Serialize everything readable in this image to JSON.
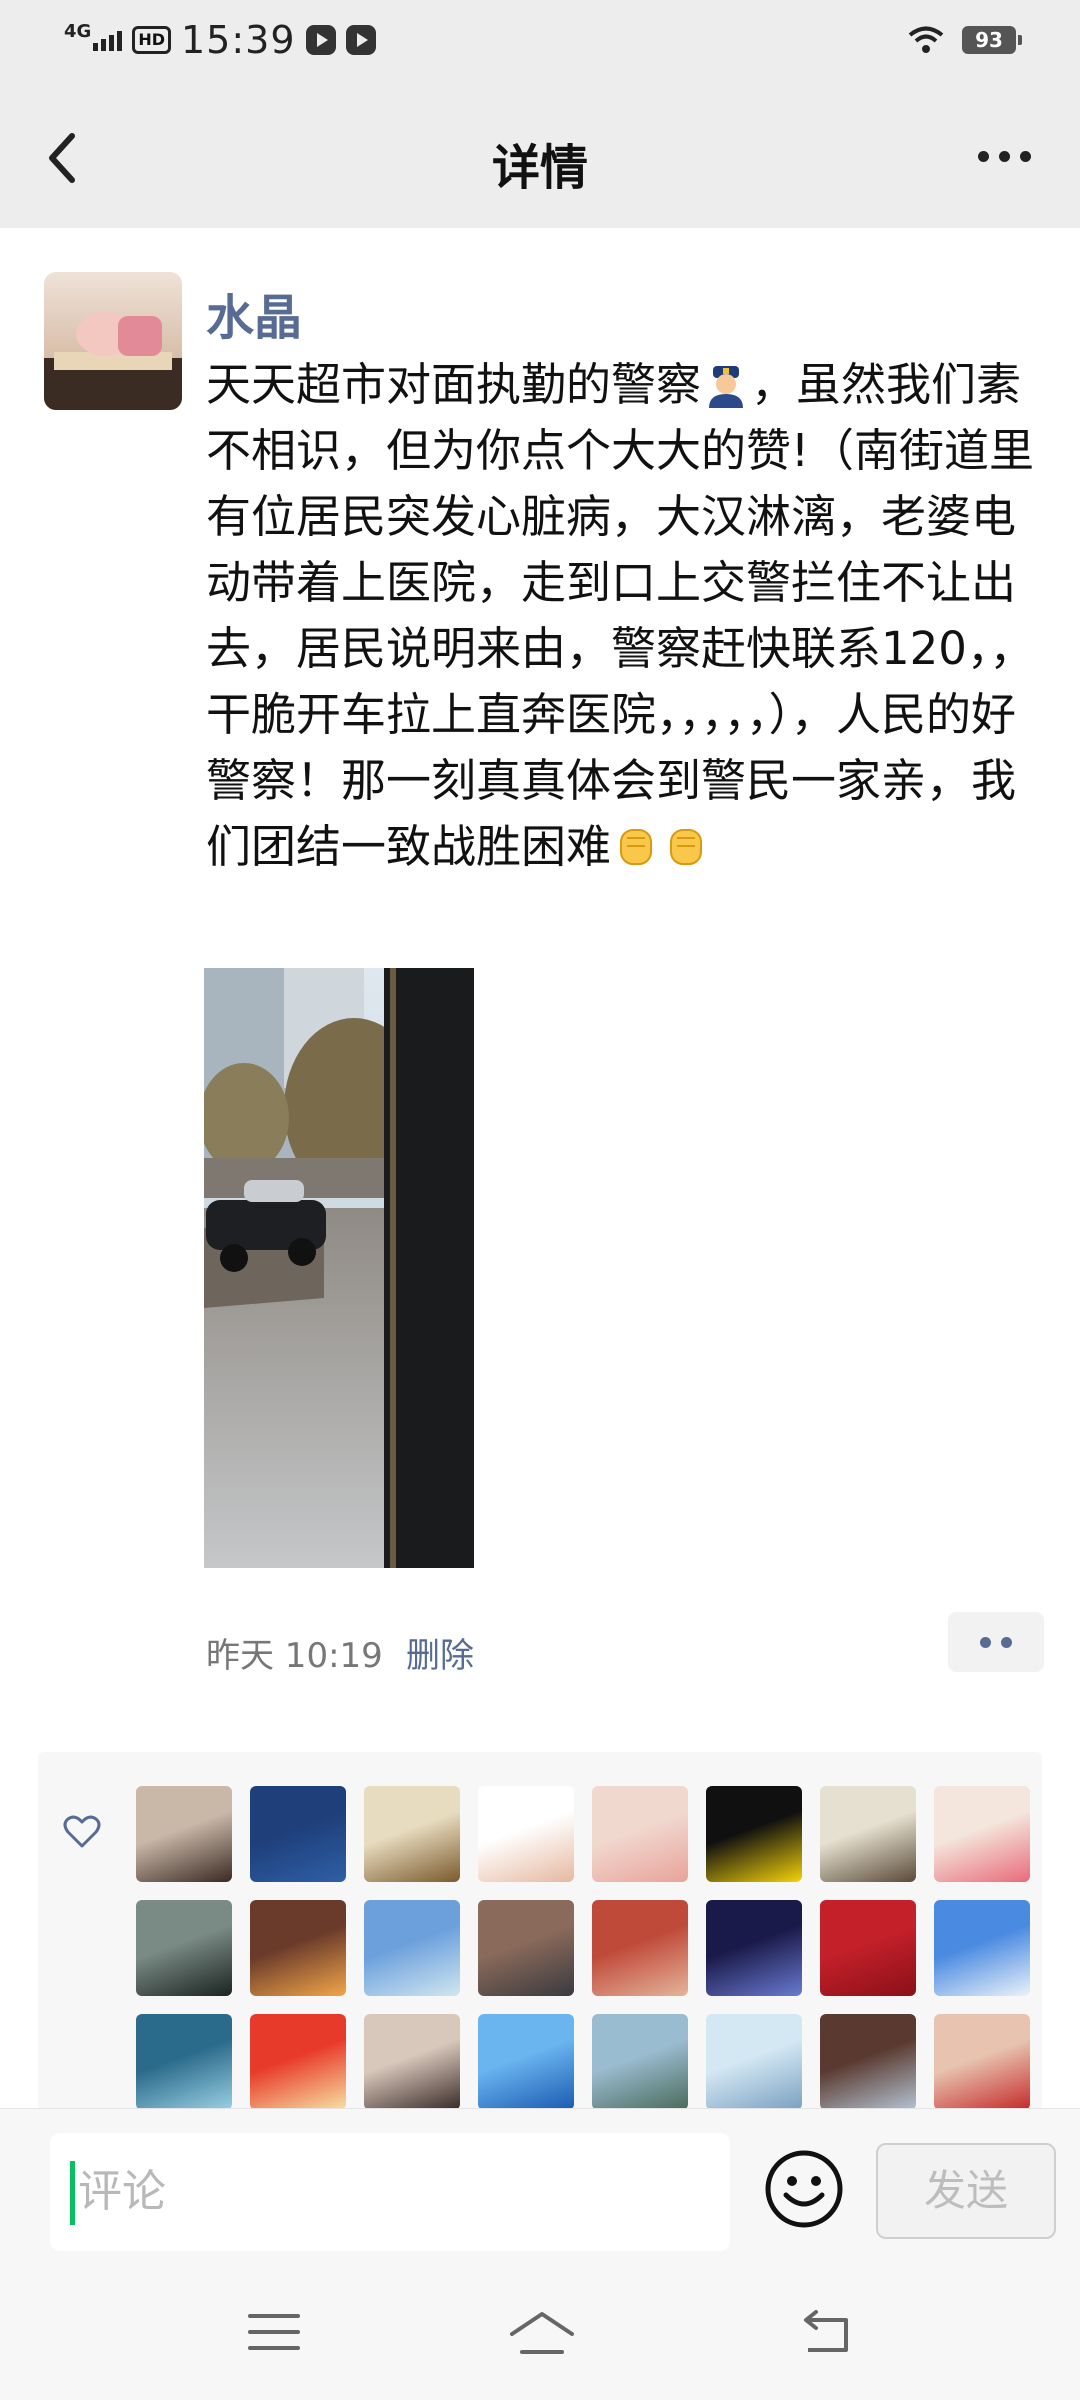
{
  "status_bar": {
    "network": "4G",
    "hd": "HD",
    "time": "15:39",
    "battery": "93"
  },
  "nav": {
    "title": "详情"
  },
  "post": {
    "author": "水晶",
    "text_parts": [
      "天天超市对面执勤的警察",
      "，虽然我们素不相识，但为你点个大大的赞!（南街道里有位居民突发心脏病，大汉淋漓，老婆电动带着上医院，走到口上交警拦住不让出去，居民说明来由，警察赶快联系120，，干脆开车拉上直奔医院，，，，，），人民的好警察！那一刻真真体会到警民一家亲，我们团结一致战胜困难"
    ],
    "icons": [
      "police-officer-emoji",
      "raised-fist-emoji",
      "raised-fist-emoji"
    ],
    "time": "昨天 10:19",
    "delete_label": "删除"
  },
  "likes": {
    "icon": "heart-outline-icon",
    "avatars": [
      {
        "colors": [
          "#c9b8a8",
          "#3a2a24"
        ]
      },
      {
        "colors": [
          "#1e3f7a",
          "#2f5fa6"
        ]
      },
      {
        "colors": [
          "#e8dcc0",
          "#7a5a2c"
        ]
      },
      {
        "colors": [
          "#ffffff",
          "#e6b8a0"
        ]
      },
      {
        "colors": [
          "#f1d8cf",
          "#e8a39a"
        ]
      },
      {
        "colors": [
          "#101010",
          "#f5d30a"
        ]
      },
      {
        "colors": [
          "#e6e0d0",
          "#5a4a38"
        ]
      },
      {
        "colors": [
          "#f4e6dc",
          "#e86b7a"
        ]
      },
      {
        "colors": [
          "#7a8a84",
          "#1b2422"
        ]
      },
      {
        "colors": [
          "#6a3a2a",
          "#f2a64a"
        ]
      },
      {
        "colors": [
          "#6ca0dc",
          "#d0e6f0"
        ]
      },
      {
        "colors": [
          "#8a6a5a",
          "#3a3a40"
        ]
      },
      {
        "colors": [
          "#c04a3a",
          "#e4b49a"
        ]
      },
      {
        "colors": [
          "#1a1a4a",
          "#6a7ad0"
        ]
      },
      {
        "colors": [
          "#c4202a",
          "#8a1018"
        ]
      },
      {
        "colors": [
          "#4a8ae0",
          "#eaf2fa"
        ]
      },
      {
        "colors": [
          "#2a6a8a",
          "#9ad0e4"
        ]
      },
      {
        "colors": [
          "#e83a2a",
          "#f6e2a4"
        ]
      },
      {
        "colors": [
          "#d8c8bc",
          "#3a2a28"
        ]
      },
      {
        "colors": [
          "#6ab4f0",
          "#1a5ab0"
        ]
      },
      {
        "colors": [
          "#9abcd0",
          "#4a6a5a"
        ]
      },
      {
        "colors": [
          "#d4e8f4",
          "#7aa0c0"
        ]
      },
      {
        "colors": [
          "#5a3a30",
          "#b4c4d4"
        ]
      },
      {
        "colors": [
          "#e8c4b0",
          "#c42a2a"
        ]
      }
    ]
  },
  "input": {
    "placeholder": "评论",
    "send_label": "发送"
  }
}
